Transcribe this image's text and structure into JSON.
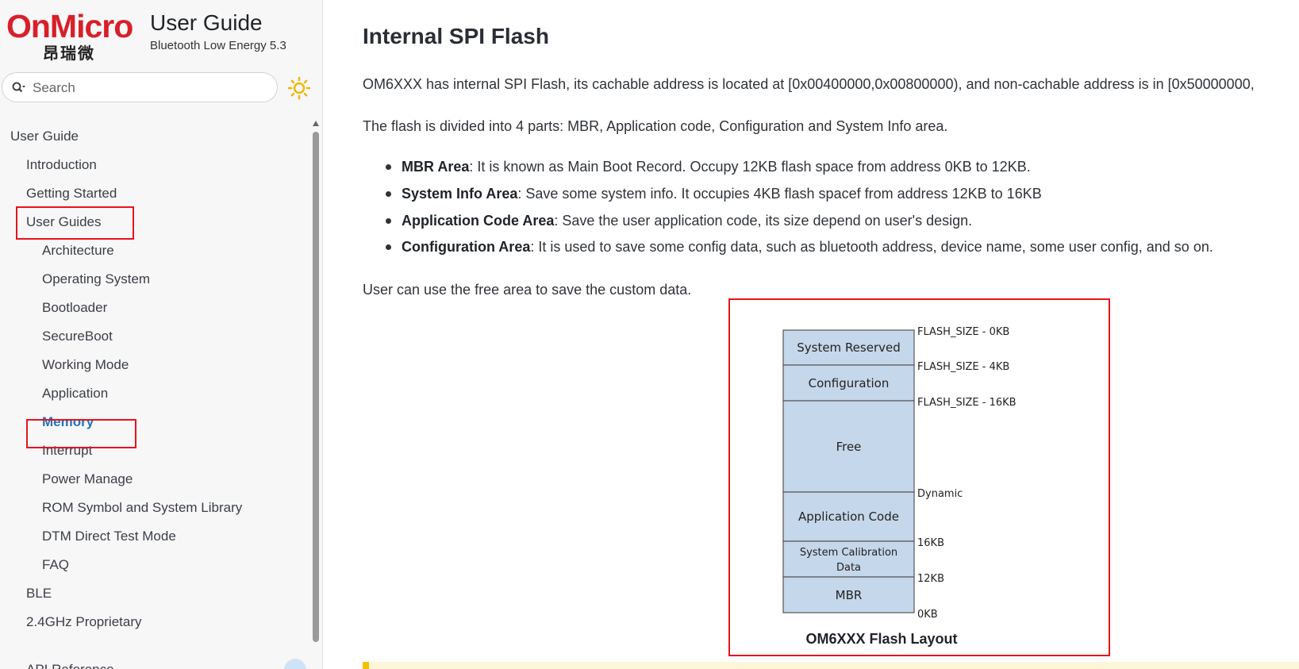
{
  "brand": {
    "logo_text": "OnMicro",
    "logo_cn": "昂瑞微",
    "title": "User Guide",
    "subtitle": "Bluetooth Low Energy 5.3"
  },
  "search": {
    "placeholder": "Search"
  },
  "theme_toggle_icon": "sun-icon",
  "colors": {
    "brand_red": "#d7202a",
    "active_link": "#2274b8",
    "highlight_box": "#e5141c",
    "diagram_fill": "#c5d7ea"
  },
  "nav": {
    "root": "User Guide",
    "introduction": "Introduction",
    "getting_started": "Getting Started",
    "user_guides": "User Guides",
    "children": [
      "Architecture",
      "Operating System",
      "Bootloader",
      "SecureBoot",
      "Working Mode",
      "Application",
      "Memory",
      "Interrupt",
      "Power Manage",
      "ROM Symbol and System Library",
      "DTM Direct Test Mode",
      "FAQ"
    ],
    "active": "Memory",
    "ble": "BLE",
    "proprietary": "2.4GHz Proprietary",
    "cut_off": "API Reference"
  },
  "content": {
    "heading": "Internal SPI Flash",
    "intro": "OM6XXX has internal SPI Flash, its cachable address is located at [0x00400000,0x00800000), and non-cachable address is in [0x50000000,",
    "divided": "The flash is divided into 4 parts: MBR, Application code, Configuration and System Info area.",
    "bullets": [
      {
        "term": "MBR Area",
        "text": ": It is known as Main Boot Record. Occupy 12KB flash space from address 0KB to 12KB."
      },
      {
        "term": "System Info Area",
        "text": ": Save some system info. It occupies 4KB flash spacef from address 12KB to 16KB"
      },
      {
        "term": "Application Code Area",
        "text": ": Save the user application code, its size depend on user's design."
      },
      {
        "term": "Configuration Area",
        "text": ": It is used to save some config data, such as bluetooth address, device name, some user config, and so on."
      }
    ],
    "free_area": "User can use the free area to save the custom data."
  },
  "figure": {
    "caption": "OM6XXX Flash Layout",
    "blocks": [
      {
        "label": "System Reserved"
      },
      {
        "label": "Configuration"
      },
      {
        "label": "Free"
      },
      {
        "label": "Application Code"
      },
      {
        "label_line1": "System Calibration",
        "label_line2": "Data"
      },
      {
        "label": "MBR"
      }
    ],
    "addresses": [
      "FLASH_SIZE - 0KB",
      "FLASH_SIZE - 4KB",
      "FLASH_SIZE - 16KB",
      "Dynamic",
      "16KB",
      "12KB",
      "0KB"
    ]
  }
}
